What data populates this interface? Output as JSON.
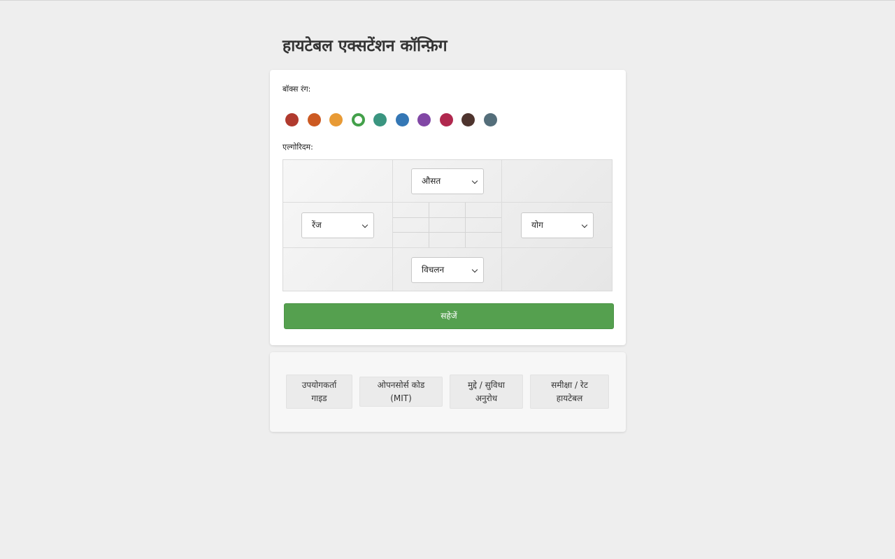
{
  "page": {
    "title": "हायटेबल एक्सटेंशन कॉन्फ़िग"
  },
  "config": {
    "color_label": "बॉक्स रंग:",
    "colors": [
      {
        "name": "red",
        "hex": "#b03a2e"
      },
      {
        "name": "dark-orange",
        "hex": "#cc5a22"
      },
      {
        "name": "orange",
        "hex": "#e89a35"
      },
      {
        "name": "green",
        "hex": "#43a04a"
      },
      {
        "name": "teal",
        "hex": "#3a9580"
      },
      {
        "name": "blue",
        "hex": "#3477b5"
      },
      {
        "name": "purple",
        "hex": "#8147a5"
      },
      {
        "name": "crimson",
        "hex": "#b0284e"
      },
      {
        "name": "dark-brown",
        "hex": "#4e342e"
      },
      {
        "name": "slate",
        "hex": "#546e7a"
      }
    ],
    "selected_color_index": 3,
    "algorithm_label": "एल्गोरिदम:",
    "algorithms": {
      "top": "औसत",
      "left": "रेंज",
      "right": "योग",
      "bottom": "विचलन"
    },
    "save_label": "सहेजें"
  },
  "links": {
    "user_guide_line1": "उपयोगकर्ता",
    "user_guide_line2": "गाइड",
    "open_source_line1": "ओपनसोर्स कोड",
    "open_source_line2": "(MIT)",
    "issues_line1": "मुद्दे / सुविधा",
    "issues_line2": "अनुरोध",
    "review_line1": "समीक्षा / रेट",
    "review_line2": "हायटेबल"
  },
  "theme": {
    "accent": "#55a04f",
    "background": "#eeeeee",
    "card": "#ffffff"
  }
}
